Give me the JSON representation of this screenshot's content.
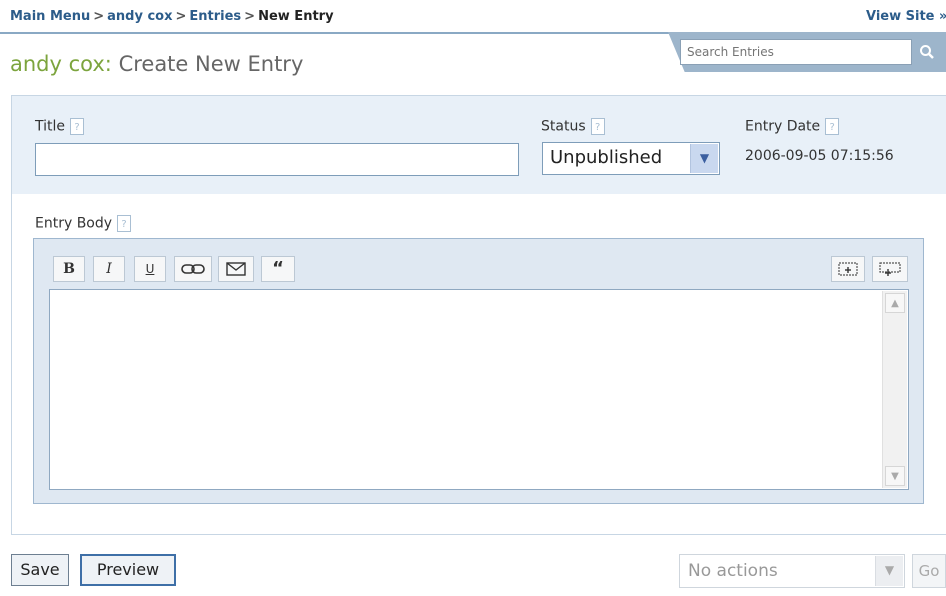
{
  "breadcrumb": {
    "items": [
      "Main Menu",
      "andy cox",
      "Entries"
    ],
    "current": "New Entry",
    "separator": ">"
  },
  "header": {
    "view_site": "View Site",
    "view_site_arrow": "»",
    "search": {
      "placeholder": "Search Entries",
      "icon": "search-icon"
    },
    "blog_name": "andy cox:",
    "page_title": "Create New Entry"
  },
  "form": {
    "title_label": "Title",
    "help_mark": "?",
    "title_value": "",
    "status_label": "Status",
    "status_value": "Unpublished",
    "entry_date_label": "Entry Date",
    "entry_date_value": "2006-09-05 07:15:56",
    "entry_body_label": "Entry Body"
  },
  "toolbar": {
    "bold": "B",
    "italic": "I",
    "underline": "U",
    "link": "link-icon",
    "email": "email-icon",
    "quote": "“",
    "insert_file": "insert-file-icon",
    "insert_image": "insert-image-icon"
  },
  "footer": {
    "save_label": "Save",
    "preview_label": "Preview",
    "actions_value": "No actions",
    "go_label": "Go"
  },
  "colors": {
    "link": "#2c5c8a",
    "blog_name": "#7ca43d",
    "panel_bg": "#e8f0f8",
    "accent_blue": "#9db5cb"
  }
}
